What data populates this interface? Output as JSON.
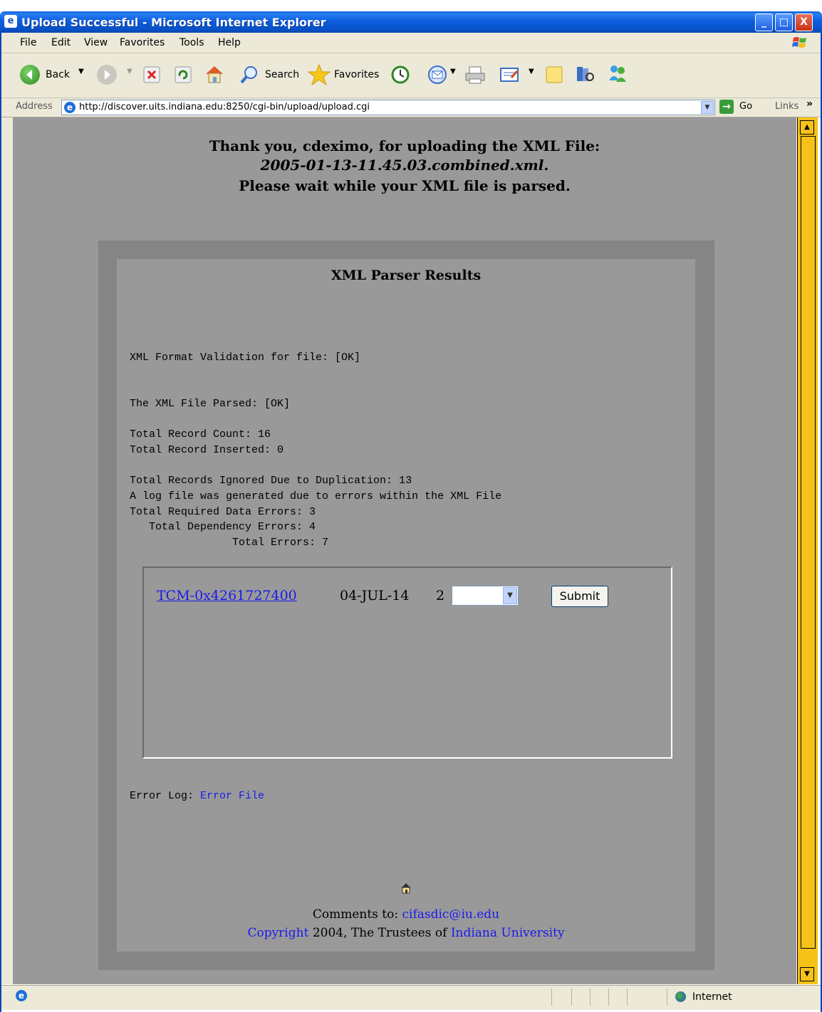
{
  "window": {
    "title": "Upload Successful - Microsoft Internet Explorer",
    "minimize": "_",
    "maximize": "□",
    "close": "X"
  },
  "menu": [
    "File",
    "Edit",
    "View",
    "Favorites",
    "Tools",
    "Help"
  ],
  "toolbar": {
    "back": "Back",
    "search": "Search",
    "favorites": "Favorites"
  },
  "address": {
    "label": "Address",
    "url": "http://discover.uits.indiana.edu:8250/cgi-bin/upload/upload.cgi",
    "go": "Go",
    "links": "Links",
    "links_chevron": "»"
  },
  "page": {
    "heading_line1": "Thank you, cdeximo, for uploading the XML File:",
    "heading_line2": "2005-01-13-11.45.03.combined.xml.",
    "heading_line3": "Please wait while your XML file is parsed.",
    "panel_title": "XML Parser Results",
    "validation": "XML Format Validation for file: [OK]",
    "parsed": "The XML File Parsed: [OK]",
    "record_count": "Total Record Count: 16",
    "record_inserted": "Total Record Inserted: 0",
    "ignored": "Total Records Ignored Due to Duplication: 13",
    "log_generated": "A log file was generated due to errors within the XML File",
    "required_errors": "Total Required Data Errors: 3",
    "dependency_errors": "   Total Dependency Errors: 4",
    "total_errors": "                Total Errors: 7",
    "result_row": {
      "link": "TCM-0x4261727400",
      "date": "04-JUL-14",
      "count": "2",
      "select_value": "",
      "submit": "Submit"
    },
    "error_log_label": "Error Log:",
    "error_log_link": "Error File",
    "footer_comments_prefix": "Comments to:",
    "footer_email": "cifasdic@iu.edu",
    "footer_copyright_link": "Copyright",
    "footer_copyright_mid": "2004, The Trustees of",
    "footer_university": "Indiana University"
  },
  "status": {
    "zone": "Internet"
  },
  "colors": {
    "page_bg": "#999999",
    "outer_panel": "#858585",
    "scrollbar": "#f6c21a",
    "link": "#1a1aee",
    "titlebar": "#0a5bd6"
  },
  "icons": [
    "ie-icon",
    "back-icon",
    "forward-icon",
    "stop-icon",
    "refresh-icon",
    "home-icon",
    "search-icon",
    "favorites-icon",
    "history-icon",
    "mail-icon",
    "print-icon",
    "edit-icon",
    "notes-icon",
    "research-icon",
    "messenger-icon",
    "go-icon",
    "globe-icon",
    "home-small-icon"
  ]
}
